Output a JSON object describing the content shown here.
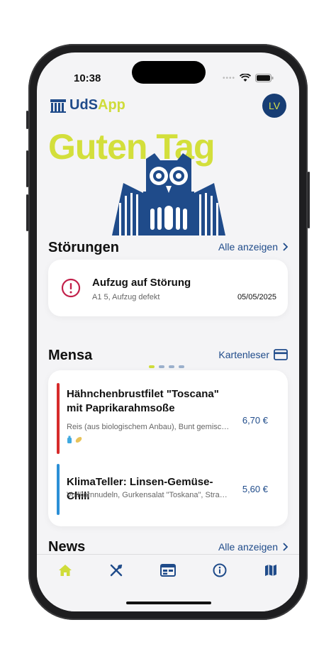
{
  "status_bar": {
    "time": "10:38"
  },
  "header": {
    "logo_uds": "UdS",
    "logo_app": "App",
    "avatar_initials": "LV",
    "greeting": "Guten Tag"
  },
  "stoerungen": {
    "title": "Störungen",
    "link": "Alle anzeigen",
    "item": {
      "title": "Aufzug auf Störung",
      "subtitle": "A1 5, Aufzug defekt",
      "date": "05/05/2025"
    },
    "pager_count": 4,
    "pager_active": 0
  },
  "mensa": {
    "title": "Mensa",
    "link": "Kartenleser",
    "meals": [
      {
        "name": "Hähnchenbrustfilet \"Toscana\" mit Paprikarahmsoße",
        "description": "Reis (aus biologischem Anbau), Bunt gemischter Salat",
        "price": "6,70 €",
        "bar_color": "#d62b2b"
      },
      {
        "name": "KlimaTeller: Linsen-Gemüse-Chili",
        "description": "Vollkornnudeln, Gurkensalat \"Toskana\", Stracciatella",
        "price": "5,60 €",
        "bar_color": "#2b8fd6"
      }
    ]
  },
  "news": {
    "title": "News",
    "link": "Alle anzeigen"
  },
  "tabbar": {
    "items": [
      {
        "icon": "home-icon",
        "active": true
      },
      {
        "icon": "fork-knife-icon",
        "active": false
      },
      {
        "icon": "calendar-table-icon",
        "active": false
      },
      {
        "icon": "info-icon",
        "active": false
      },
      {
        "icon": "map-icon",
        "active": false
      }
    ]
  },
  "colors": {
    "primary": "#1f4b8a",
    "accent": "#cfdc3a",
    "alert": "#c2204a"
  }
}
